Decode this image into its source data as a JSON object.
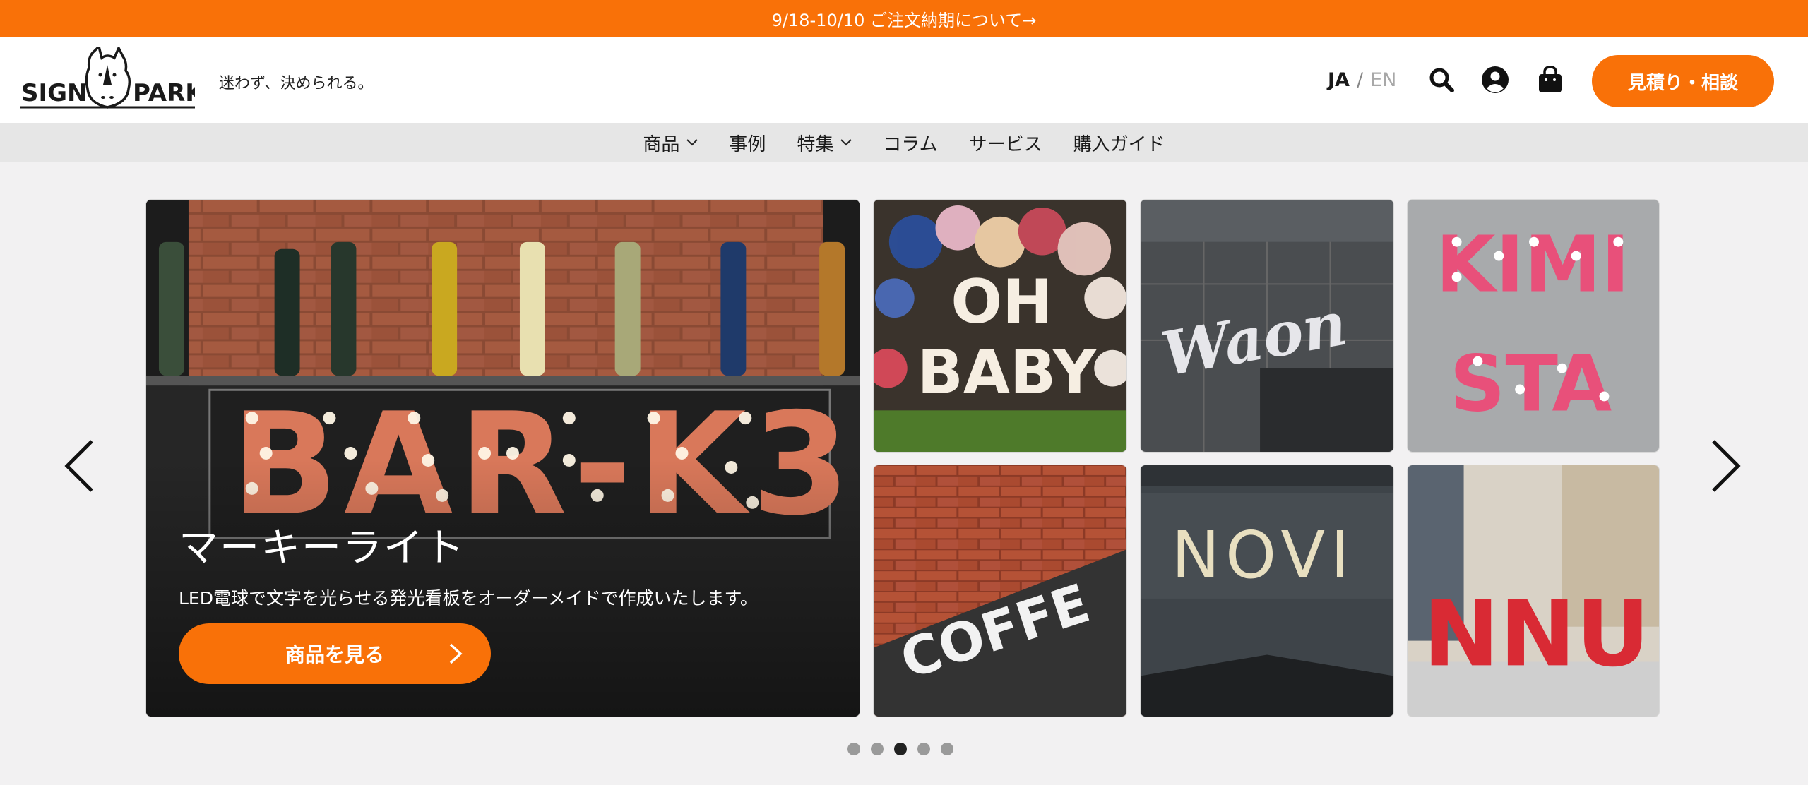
{
  "announcement": {
    "text": "9/18-10/10 ご注文納期について→"
  },
  "header": {
    "logo_text": "SIGN PARK",
    "tagline": "迷わず、決められる。",
    "lang_ja": "JA",
    "lang_sep": "/",
    "lang_en": "EN",
    "search_icon": "search-icon",
    "account_icon": "account-icon",
    "cart_icon": "cart-icon",
    "cta_label": "見積り・相談",
    "accent_color": "#f97108"
  },
  "nav": {
    "items": [
      {
        "label": "商品",
        "has_dropdown": true
      },
      {
        "label": "事例",
        "has_dropdown": false
      },
      {
        "label": "特集",
        "has_dropdown": true
      },
      {
        "label": "コラム",
        "has_dropdown": false
      },
      {
        "label": "サービス",
        "has_dropdown": false
      },
      {
        "label": "購入ガイド",
        "has_dropdown": false
      }
    ]
  },
  "hero": {
    "title": "マーキーライト",
    "description": "LED電球で文字を光らせる発光看板をオーダーメイドで作成いたします。",
    "button_label": "商品を見る",
    "main_sign_text": "BAR-K3.",
    "thumbnails": [
      {
        "sign_text": "OH BABY"
      },
      {
        "sign_text": "Waon"
      },
      {
        "sign_text": "KIMI STA"
      },
      {
        "sign_text": "COFFE"
      },
      {
        "sign_text": "NOVI"
      },
      {
        "sign_text": "NNU"
      }
    ]
  },
  "carousel": {
    "dot_count": 5,
    "active_index": 2
  }
}
